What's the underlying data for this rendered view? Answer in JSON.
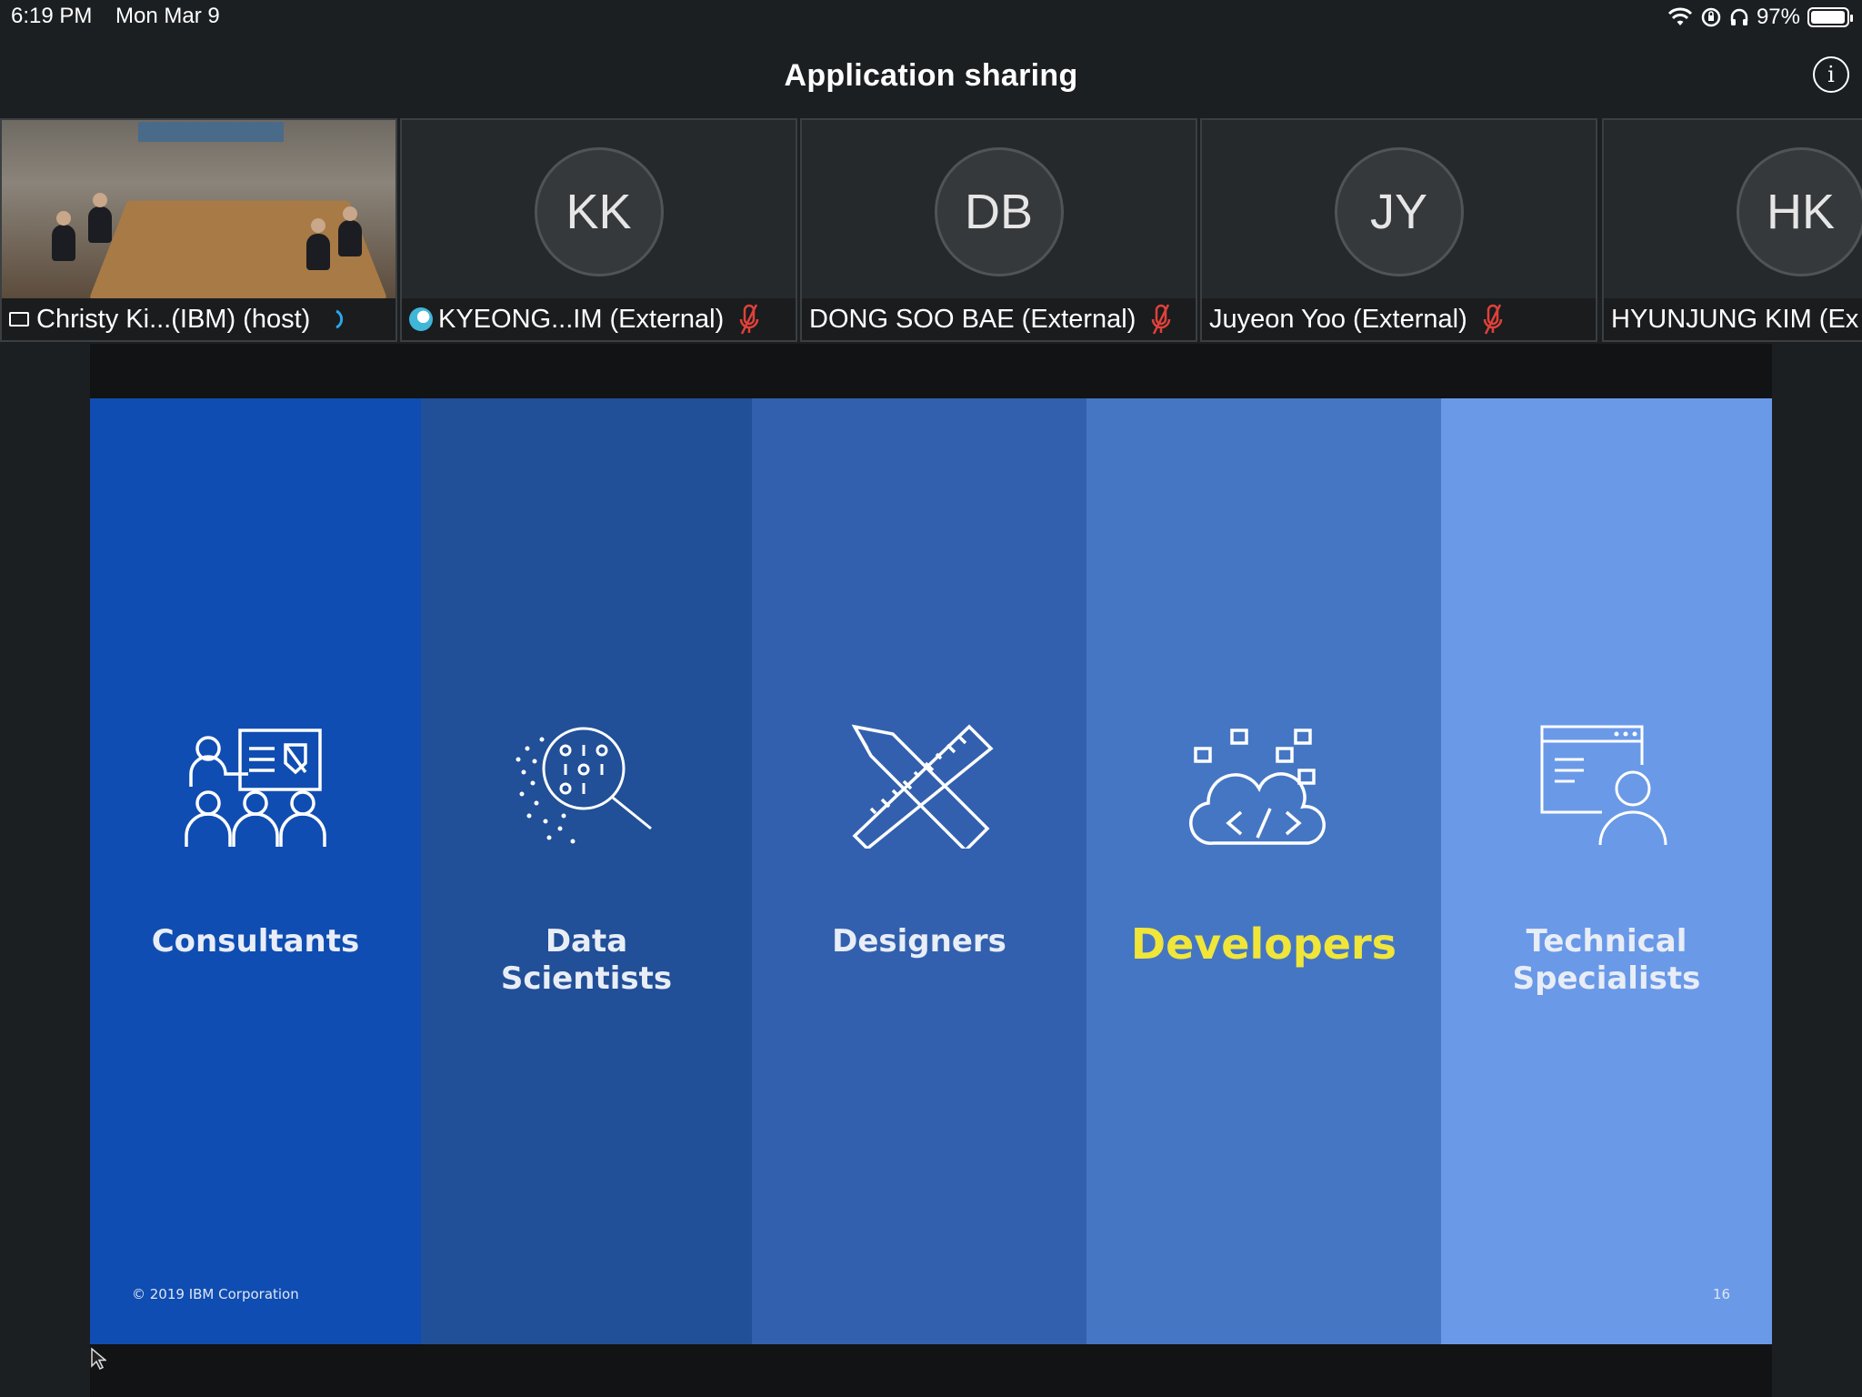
{
  "status_bar": {
    "time": "6:19 PM",
    "date": "Mon Mar 9",
    "battery": "97%",
    "battery_level": 0.97
  },
  "header": {
    "title": "Application sharing",
    "info_icon": "info-icon"
  },
  "participants": [
    {
      "name": "Christy Ki...(IBM) (host)",
      "type": "video",
      "audio": "speaking"
    },
    {
      "name": "KYEONG...IM (External)",
      "initials": "KK",
      "audio": "muted"
    },
    {
      "name": "DONG SOO BAE (External)",
      "initials": "DB",
      "audio": "muted"
    },
    {
      "name": "Juyeon Yoo (External)",
      "initials": "JY",
      "audio": "muted"
    },
    {
      "name": "HYUNJUNG KIM (Ex",
      "initials": "HK"
    }
  ],
  "slide": {
    "columns": [
      {
        "label": "Consultants",
        "color": "#0f4db2",
        "icon": "consultant-presentation-icon"
      },
      {
        "label": "Data\nScientists",
        "color": "#214f98",
        "icon": "data-magnifier-icon"
      },
      {
        "label": "Designers",
        "color": "#3260ae",
        "icon": "pencil-ruler-icon"
      },
      {
        "label": "Developers",
        "color": "#4576c4",
        "icon": "cloud-code-icon",
        "highlight_color": "#f0e63a"
      },
      {
        "label": "Technical\nSpecialists",
        "color": "#6a99e8",
        "icon": "user-screen-icon"
      }
    ],
    "copyright": "© 2019 IBM Corporation",
    "page_number": "16"
  },
  "colors": {
    "background": "#1c1f22",
    "muted_mic": "#e0413a",
    "speaking": "#2aa6e8"
  }
}
